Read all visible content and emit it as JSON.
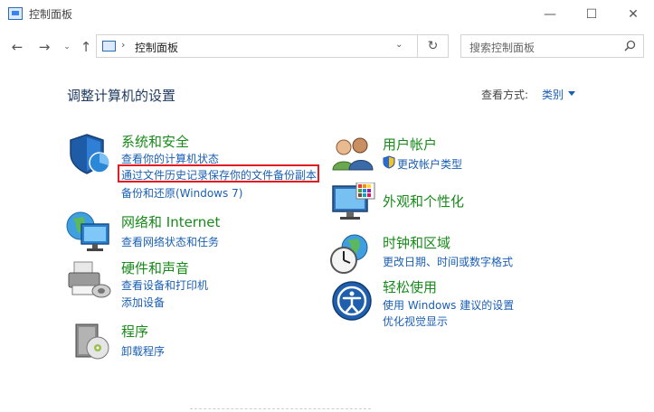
{
  "window": {
    "title": "控制面板",
    "minimize_glyph": "—",
    "maximize_glyph": "☐",
    "close_glyph": "✕"
  },
  "nav": {
    "back_glyph": "←",
    "forward_glyph": "→",
    "recent_glyph": "⌄",
    "up_glyph": "↑",
    "address_separator": "›",
    "address_text": "控制面板",
    "address_dropdown_glyph": "⌄",
    "refresh_glyph": "↻",
    "search_placeholder": "搜索控制面板"
  },
  "content": {
    "page_title": "调整计算机的设置",
    "view_label": "查看方式:",
    "view_value": "类别",
    "categories": {
      "security": {
        "title": "系统和安全",
        "links": [
          "查看你的计算机状态",
          "通过文件历史记录保存你的文件备份副本",
          "备份和还原(Windows 7)"
        ]
      },
      "network": {
        "title": "网络和 Internet",
        "links": [
          "查看网络状态和任务"
        ]
      },
      "hardware": {
        "title": "硬件和声音",
        "links": [
          "查看设备和打印机",
          "添加设备"
        ]
      },
      "programs": {
        "title": "程序",
        "links": [
          "卸载程序"
        ]
      },
      "accounts": {
        "title": "用户帐户",
        "links": [
          "更改帐户类型"
        ]
      },
      "appearance": {
        "title": "外观和个性化",
        "links": []
      },
      "clock": {
        "title": "时钟和区域",
        "links": [
          "更改日期、时间或数字格式"
        ]
      },
      "ease": {
        "title": "轻松使用",
        "links": [
          "使用 Windows 建议的设置",
          "优化视觉显示"
        ]
      }
    }
  },
  "colors": {
    "category_title": "#178a1a",
    "link": "#1a5fb4",
    "highlight": "#e11d24"
  }
}
